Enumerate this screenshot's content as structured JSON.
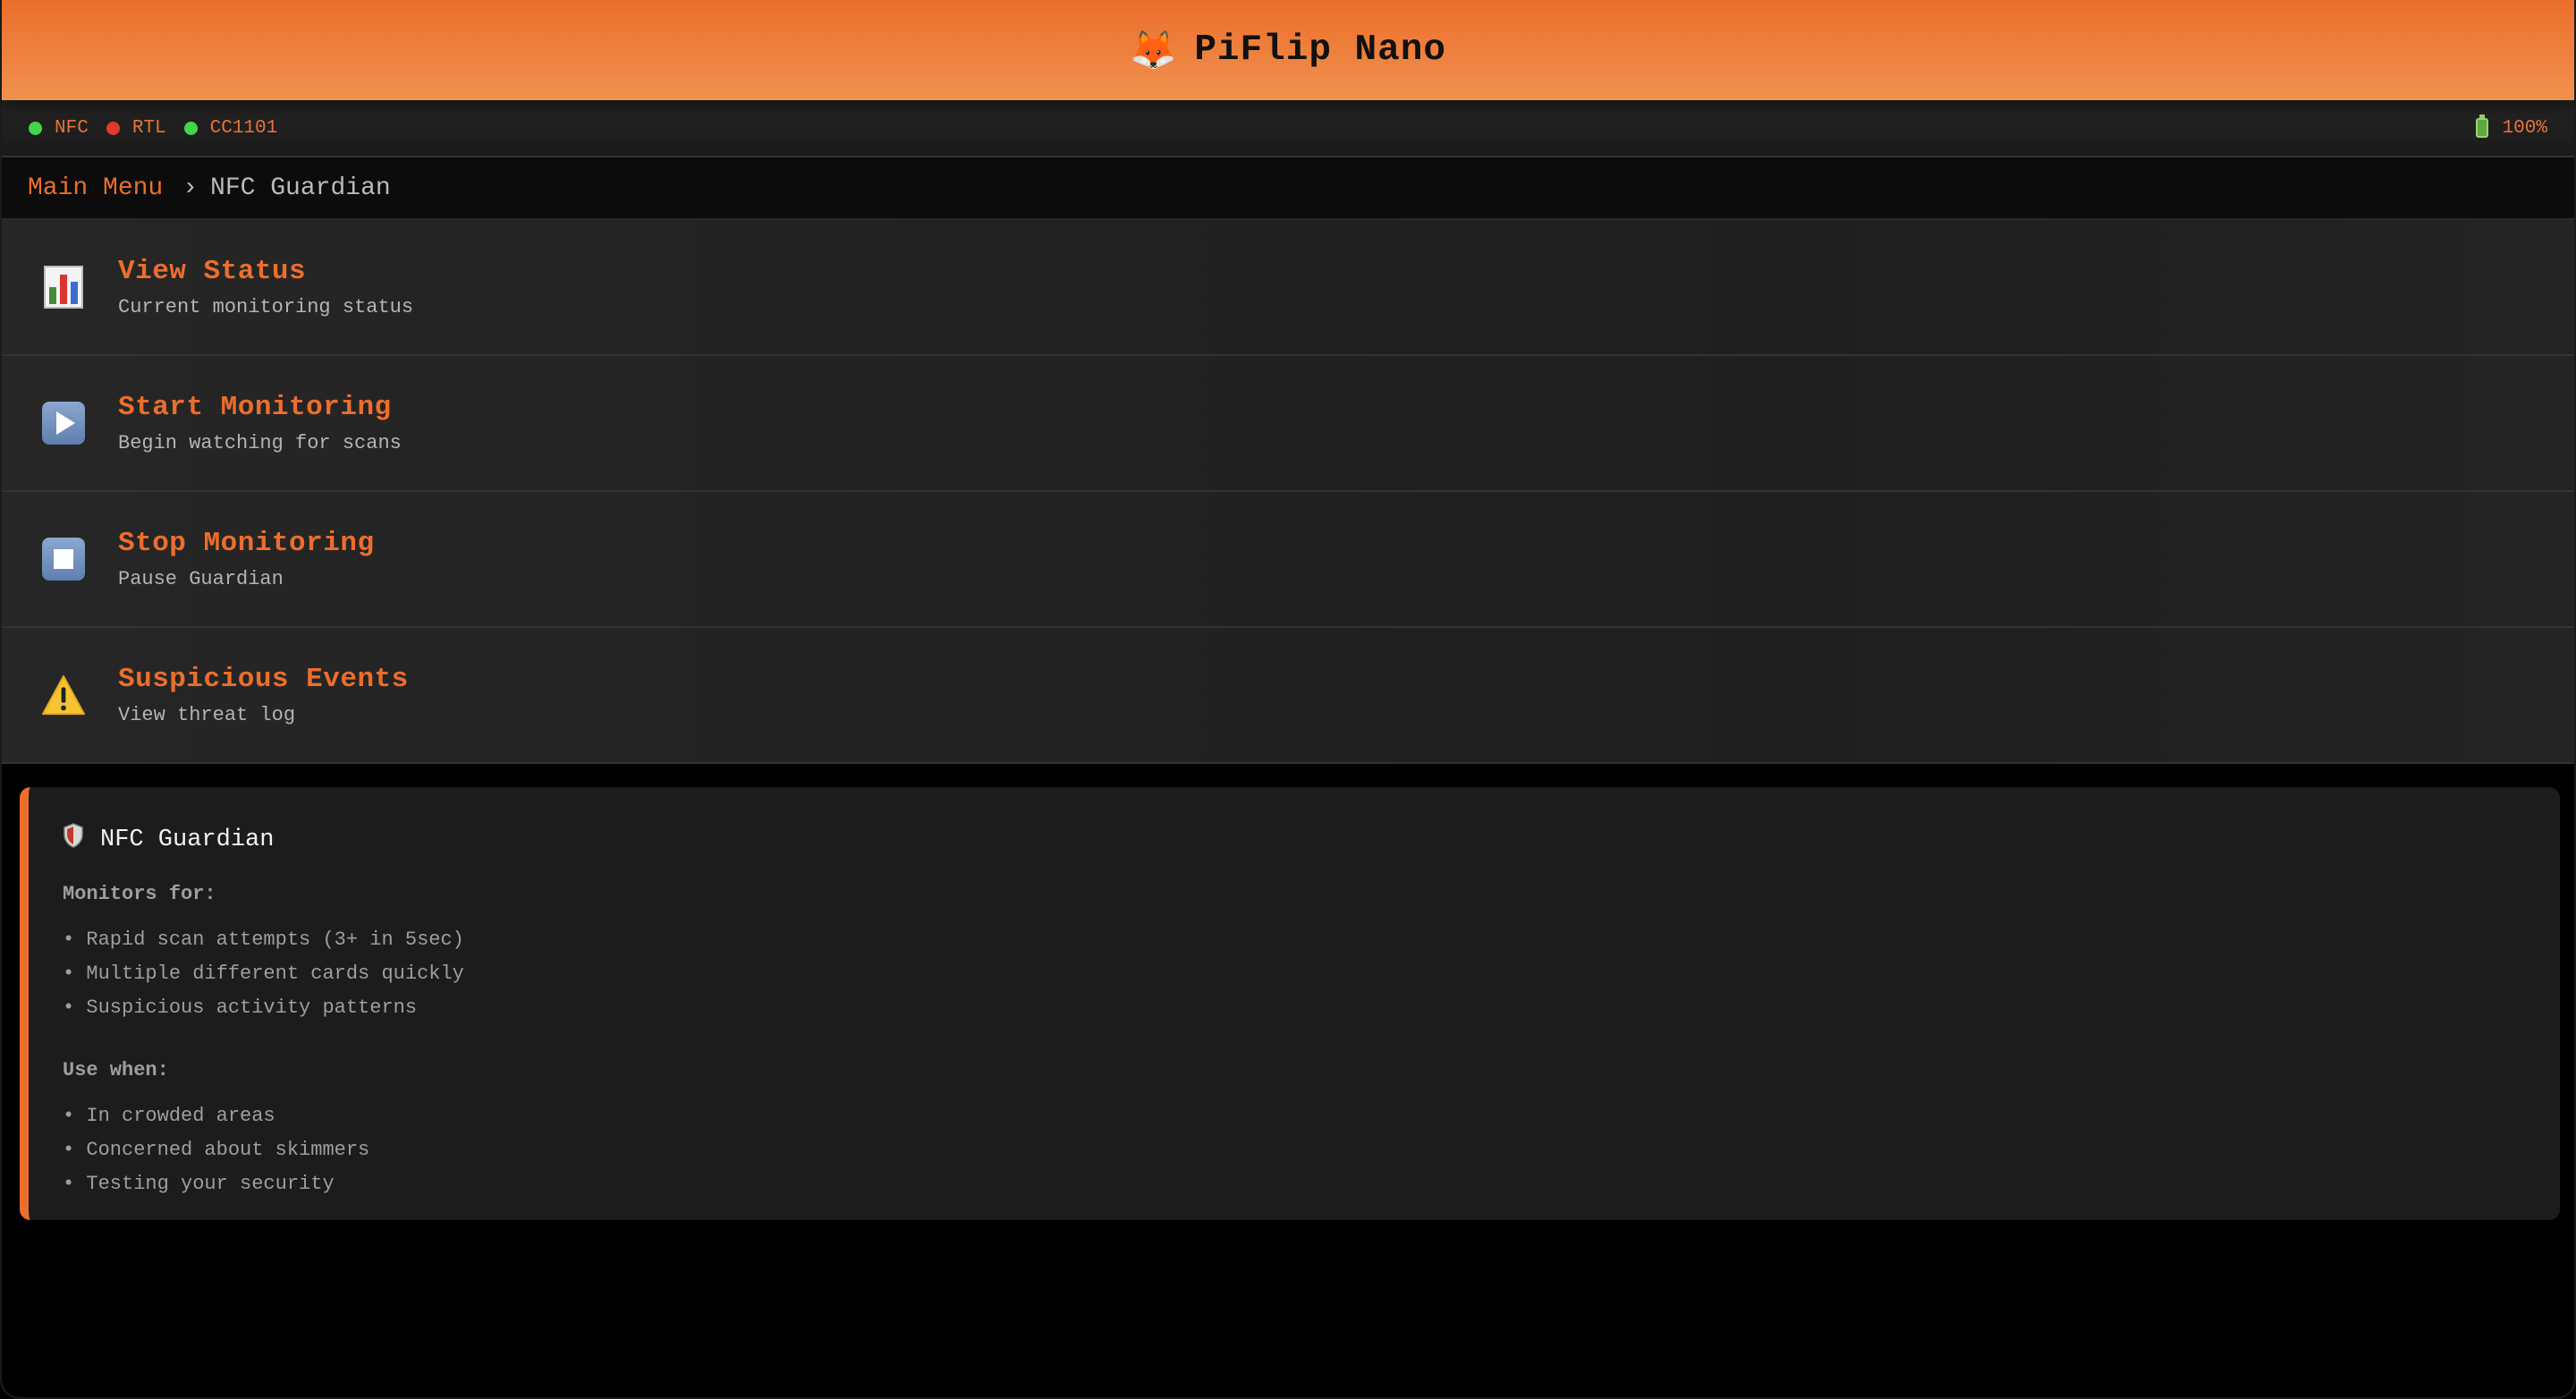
{
  "app": {
    "title": "PiFlip Nano",
    "logo_icon": "fox-icon"
  },
  "status": {
    "indicators": [
      {
        "label": "NFC",
        "color": "#44d64a"
      },
      {
        "label": "RTL",
        "color": "#e33a2e"
      },
      {
        "label": "CC1101",
        "color": "#44d64a"
      }
    ],
    "battery": "100%"
  },
  "breadcrumb": {
    "parent": "Main Menu",
    "separator": "›",
    "current": "NFC Guardian"
  },
  "menu": {
    "items": [
      {
        "label": "View Status",
        "description": "Current monitoring status",
        "icon": "bar-chart-icon"
      },
      {
        "label": "Start Monitoring",
        "description": "Begin watching for scans",
        "icon": "play-icon"
      },
      {
        "label": "Stop Monitoring",
        "description": "Pause Guardian",
        "icon": "stop-icon"
      },
      {
        "label": "Suspicious Events",
        "description": "View threat log",
        "icon": "warning-icon"
      }
    ]
  },
  "info": {
    "title": "NFC Guardian",
    "monitors_heading": "Monitors for:",
    "monitors": [
      "• Rapid scan attempts (3+ in 5sec)",
      "• Multiple different cards quickly",
      "• Suspicious activity patterns"
    ],
    "use_heading": "Use when:",
    "use_cases": [
      "• In crowded areas",
      "• Concerned about skimmers",
      "• Testing your security"
    ]
  },
  "colors": {
    "accent": "#ec6e2c",
    "status_ok": "#44d64a",
    "status_error": "#e33a2e"
  }
}
